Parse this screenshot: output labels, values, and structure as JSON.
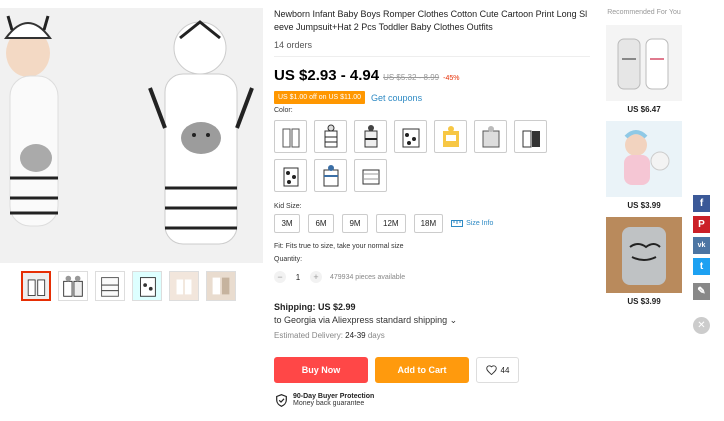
{
  "product": {
    "title": "Newborn Infant Baby Boys Romper Clothes Cotton Cute Cartoon Print Long Sleeve Jumpsuit+Hat 2 Pcs Toddler Baby Clothes Outfits",
    "orders": "14 orders",
    "price": "US $2.93 - 4.94",
    "old_price": "US $5.32 - 8.99",
    "discount": "-45%",
    "coupon_badge": "US $1.00 off on US $11.00",
    "get_coupons": "Get coupons"
  },
  "color": {
    "label": "Color:",
    "swatches": [
      "variant-1",
      "variant-2",
      "variant-3",
      "variant-4",
      "variant-5",
      "variant-6",
      "variant-7",
      "variant-8",
      "variant-9",
      "variant-10"
    ]
  },
  "size": {
    "label": "Kid Size:",
    "options": [
      "3M",
      "6M",
      "9M",
      "12M",
      "18M"
    ],
    "info": "Size Info"
  },
  "fit_text": "Fit: Fits true to size, take your normal size",
  "quantity": {
    "label": "Quantity:",
    "value": "1",
    "minus": "−",
    "plus": "+",
    "available": "479934 pieces available"
  },
  "shipping": {
    "title": "Shipping: US $2.99",
    "to": "to Georgia via Aliexpress standard shipping ⌄",
    "delivery_label": "Estimated Delivery:",
    "delivery_days": "24-39",
    "delivery_unit": "days"
  },
  "actions": {
    "buy_now": "Buy Now",
    "add_to_cart": "Add to Cart",
    "wishlist_count": "44"
  },
  "protection": {
    "title": "90-Day Buyer Protection",
    "subtitle": "Money back guarantee"
  },
  "recommended": {
    "title": "Recommended For You",
    "items": [
      {
        "price": "US $6.47"
      },
      {
        "price": "US $3.99"
      },
      {
        "price": "US $3.99"
      }
    ]
  },
  "social": {
    "facebook": "f",
    "pinterest": "P",
    "vk": "vk",
    "twitter": "t",
    "edit": "✎",
    "close": "✕"
  },
  "colors": {
    "buy_now": "#ff4747",
    "add_to_cart": "#ff9a0d",
    "coupon": "#ff9700",
    "link": "#2e8ac4",
    "discount": "#e62e04"
  }
}
